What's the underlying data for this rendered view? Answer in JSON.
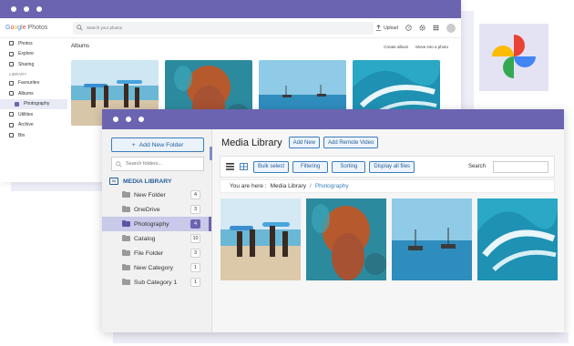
{
  "back_window": {
    "logo": {
      "word": "Google",
      "suffix": "Photos"
    },
    "search_placeholder": "Search your photos",
    "header_actions": {
      "upload": "Upload"
    },
    "nav": [
      {
        "label": "Photos",
        "icon": "photo-icon"
      },
      {
        "label": "Explore",
        "icon": "explore-icon"
      },
      {
        "label": "Sharing",
        "icon": "sharing-icon"
      }
    ],
    "library_label": "LIBRARY",
    "library_items": [
      {
        "label": "Favourites",
        "icon": "star-icon"
      },
      {
        "label": "Albums",
        "icon": "album-icon"
      }
    ],
    "sub_item": "Photography",
    "bottom_items": [
      {
        "label": "Utilities",
        "icon": "utilities-icon"
      },
      {
        "label": "Archive",
        "icon": "archive-icon"
      },
      {
        "label": "Bin",
        "icon": "bin-icon"
      }
    ],
    "albums_title": "Albums",
    "albums_actions": {
      "create": "Create album",
      "move": "Move into a photo"
    }
  },
  "front_window": {
    "add_folder_label": "Add New Folder",
    "folder_search_placeholder": "Search folders...",
    "library_heading": "MEDIA LIBRARY",
    "folders": [
      {
        "name": "New Folder",
        "count": "4",
        "active": false
      },
      {
        "name": "OneDrive",
        "count": "3",
        "active": false
      },
      {
        "name": "Photography",
        "count": "4",
        "active": true
      },
      {
        "name": "Catalog",
        "count": "10",
        "active": false
      },
      {
        "name": "File Folder",
        "count": "3",
        "active": false
      },
      {
        "name": "New Category",
        "count": "1",
        "active": false
      },
      {
        "name": "Sub Category 1",
        "count": "1",
        "active": false
      }
    ],
    "title": "Media Library",
    "title_buttons": {
      "add_new": "Add New",
      "add_remote": "Add Remote Video"
    },
    "toolbar": {
      "bulk_select": "Bulk select",
      "filtering": "Filtering",
      "sorting": "Sorting",
      "display_all": "Display all files",
      "search_label": "Search",
      "search_value": ""
    },
    "breadcrumb": {
      "prefix": "You are here :",
      "root": "Media Library",
      "sep": "/",
      "current": "Photography"
    }
  },
  "colors": {
    "accent": "#6b64b0",
    "link": "#3b7dbd"
  }
}
